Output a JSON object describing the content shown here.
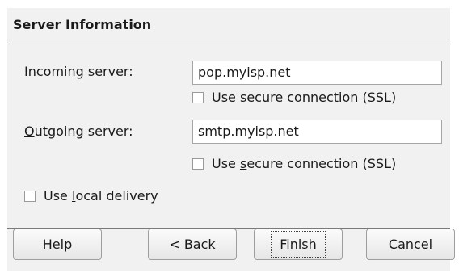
{
  "section": {
    "title": "Server Information"
  },
  "incoming": {
    "label": "Incoming server:",
    "value": "pop.myisp.net",
    "ssl": {
      "checked": false,
      "pre": "",
      "key": "U",
      "post": "se secure connection (SSL)"
    }
  },
  "outgoing": {
    "label_key": "O",
    "label_rest": "utgoing server:",
    "value": "smtp.myisp.net",
    "ssl": {
      "checked": false,
      "pre": "Use ",
      "key": "s",
      "post": "ecure connection (SSL)"
    }
  },
  "local_delivery": {
    "checked": false,
    "pre": "Use ",
    "key": "l",
    "post": "ocal delivery"
  },
  "buttons": {
    "help": {
      "pre": "",
      "key": "H",
      "post": "elp"
    },
    "back": {
      "pre": "< ",
      "key": "B",
      "post": "ack"
    },
    "finish": {
      "pre": "",
      "key": "F",
      "post": "inish"
    },
    "cancel": {
      "pre": "",
      "key": "C",
      "post": "ancel"
    }
  }
}
